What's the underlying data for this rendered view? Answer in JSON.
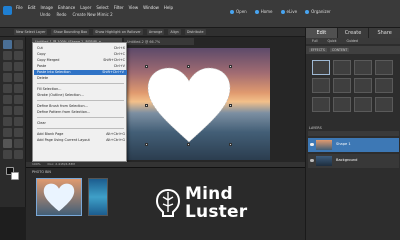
{
  "titlebar": {
    "undo": "Undo",
    "redo": "Redo",
    "file_name": "Create New Mimic 2"
  },
  "menubar": {
    "items": [
      "File",
      "Edit",
      "Image",
      "Enhance",
      "Layer",
      "Select",
      "Filter",
      "View",
      "Window",
      "Help"
    ]
  },
  "quick_links": [
    {
      "label": "Open",
      "icon": "folder-icon"
    },
    {
      "label": "Home",
      "icon": "home-icon"
    },
    {
      "label": "eLive",
      "icon": "elive-icon"
    },
    {
      "label": "Organizer",
      "icon": "organizer-icon"
    }
  ],
  "options_bar": [
    "New Select Layer",
    "Show Bounding Box",
    "Show Highlight on Rollover",
    "Arrange",
    "Align",
    "Distribute"
  ],
  "document_tabs": [
    "Untitled-1 @ 100% (Shape 1, RGB/8) ×",
    "Untitled-2 @ 66.7%"
  ],
  "context_menu": {
    "sections": [
      [
        {
          "label": "Cut",
          "shortcut": "Ctrl+X"
        },
        {
          "label": "Copy",
          "shortcut": "Ctrl+C"
        },
        {
          "label": "Copy Merged",
          "shortcut": "Shift+Ctrl+C"
        },
        {
          "label": "Paste",
          "shortcut": "Ctrl+V"
        },
        {
          "label": "Paste Into Selection",
          "shortcut": "Shift+Ctrl+V"
        },
        {
          "label": "Delete",
          "shortcut": ""
        }
      ],
      [
        {
          "label": "Fill Selection...",
          "shortcut": ""
        },
        {
          "label": "Stroke (Outline) Selection...",
          "shortcut": ""
        }
      ],
      [
        {
          "label": "Define Brush from Selection...",
          "shortcut": ""
        },
        {
          "label": "Define Pattern from Selection...",
          "shortcut": ""
        }
      ],
      [
        {
          "label": "Clear",
          "shortcut": ""
        }
      ],
      [
        {
          "label": "Add Blank Page",
          "shortcut": "Alt+Ctrl+G"
        },
        {
          "label": "Add Page Using Current Layout",
          "shortcut": "Alt+Ctrl+G"
        }
      ]
    ],
    "highlighted": "Paste Into Selection"
  },
  "status_bar": {
    "zoom": "100%",
    "label": "Doc: 2.41M/4.83M"
  },
  "photo_bin": {
    "label": "PHOTO BIN"
  },
  "right_panel": {
    "mode_tabs": [
      "Edit",
      "Create",
      "Share"
    ],
    "active_tab": "Edit",
    "sub_tabs": [
      "Full",
      "Quick",
      "Guided"
    ],
    "effects_strip": [
      "EFFECTS",
      "CONTENT"
    ],
    "layers_title": "LAYERS",
    "layers": [
      {
        "name": "Shape 1",
        "selected": true
      },
      {
        "name": "Background",
        "selected": false
      }
    ]
  },
  "watermark": {
    "line1": "Mind",
    "line2": "Luster"
  }
}
